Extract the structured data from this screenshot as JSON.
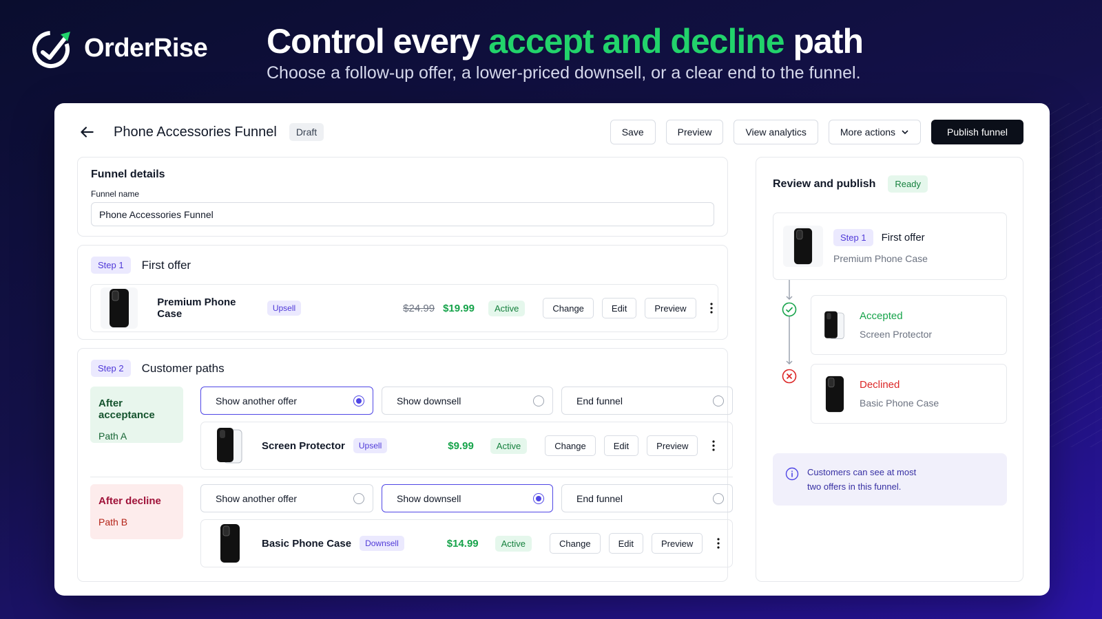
{
  "brand": {
    "name": "OrderRise"
  },
  "hero": {
    "title_start": "Control every ",
    "title_accent": "accept and decline",
    "title_end": " path",
    "subtitle": "Choose a follow-up offer, a lower-priced downsell, or a clear end to the funnel."
  },
  "topbar": {
    "title": "Phone Accessories Funnel",
    "status": "Draft",
    "actions": {
      "save": "Save",
      "preview": "Preview",
      "analytics": "View analytics",
      "more": "More actions",
      "publish": "Publish funnel"
    }
  },
  "details": {
    "title": "Funnel details",
    "name_label": "Funnel name",
    "name_value": "Phone Accessories Funnel"
  },
  "step1": {
    "badge": "Step 1",
    "title": "First offer",
    "product": {
      "name": "Premium Phone Case",
      "tag": "Upsell",
      "old_price": "$24.99",
      "price": "$19.99",
      "status": "Active"
    }
  },
  "row_actions": {
    "change": "Change",
    "edit": "Edit",
    "preview": "Preview"
  },
  "step2": {
    "badge": "Step 2",
    "title": "Customer paths",
    "options": {
      "another": "Show another offer",
      "downsell": "Show downsell",
      "end": "End funnel"
    },
    "path_a": {
      "title": "After acceptance",
      "sub": "Path A",
      "selected": "another",
      "product": {
        "name": "Screen Protector",
        "tag": "Upsell",
        "price": "$9.99",
        "status": "Active"
      }
    },
    "path_b": {
      "title": "After decline",
      "sub": "Path B",
      "selected": "downsell",
      "product": {
        "name": "Basic Phone Case",
        "tag": "Downsell",
        "price": "$14.99",
        "status": "Active"
      }
    }
  },
  "review": {
    "title": "Review and publish",
    "status": "Ready",
    "first": {
      "badge": "Step 1",
      "title": "First offer",
      "product": "Premium Phone Case"
    },
    "accepted": {
      "label": "Accepted",
      "product": "Screen Protector"
    },
    "declined": {
      "label": "Declined",
      "product": "Basic Phone Case"
    },
    "info_line1": "Customers can see at most",
    "info_line2": "two offers in this funnel."
  },
  "colors": {
    "accent_green": "#22d36b",
    "primary": "#4f46e5",
    "success": "#16a34a",
    "danger": "#dc2626"
  }
}
